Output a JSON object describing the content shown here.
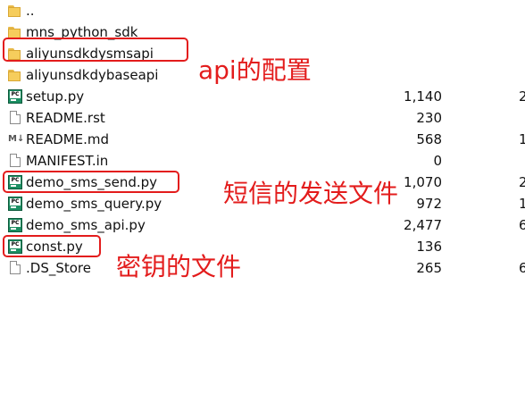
{
  "files": [
    {
      "name": "..",
      "type": "folder",
      "size": "",
      "extra": ""
    },
    {
      "name": "mns_python_sdk",
      "type": "folder",
      "size": "",
      "extra": ""
    },
    {
      "name": "aliyunsdkdysmsapi",
      "type": "folder",
      "size": "",
      "extra": ""
    },
    {
      "name": "aliyunsdkdybaseapi",
      "type": "folder",
      "size": "",
      "extra": ""
    },
    {
      "name": "setup.py",
      "type": "python",
      "size": "1,140",
      "extra": "2"
    },
    {
      "name": "README.rst",
      "type": "document",
      "size": "230",
      "extra": ""
    },
    {
      "name": "README.md",
      "type": "markdown",
      "size": "568",
      "extra": "1"
    },
    {
      "name": "MANIFEST.in",
      "type": "document",
      "size": "0",
      "extra": ""
    },
    {
      "name": "demo_sms_send.py",
      "type": "python",
      "size": "1,070",
      "extra": "2"
    },
    {
      "name": "demo_sms_query.py",
      "type": "python",
      "size": "972",
      "extra": "1"
    },
    {
      "name": "demo_sms_api.py",
      "type": "python",
      "size": "2,477",
      "extra": "6"
    },
    {
      "name": "const.py",
      "type": "python",
      "size": "136",
      "extra": ""
    },
    {
      "name": ".DS_Store",
      "type": "document",
      "size": "265",
      "extra": "6"
    }
  ],
  "annotations": {
    "api_config": "api的配置",
    "sms_send_file": "短信的发送文件",
    "secret_key_file": "密钥的文件"
  },
  "colors": {
    "annotation": "#e31c1c",
    "folder": "#f6cd5c",
    "python_icon": "#1c8f63"
  },
  "icons": {
    "folder": "folder-icon",
    "python": "python-file-icon",
    "document": "document-icon",
    "markdown": "markdown-icon"
  }
}
